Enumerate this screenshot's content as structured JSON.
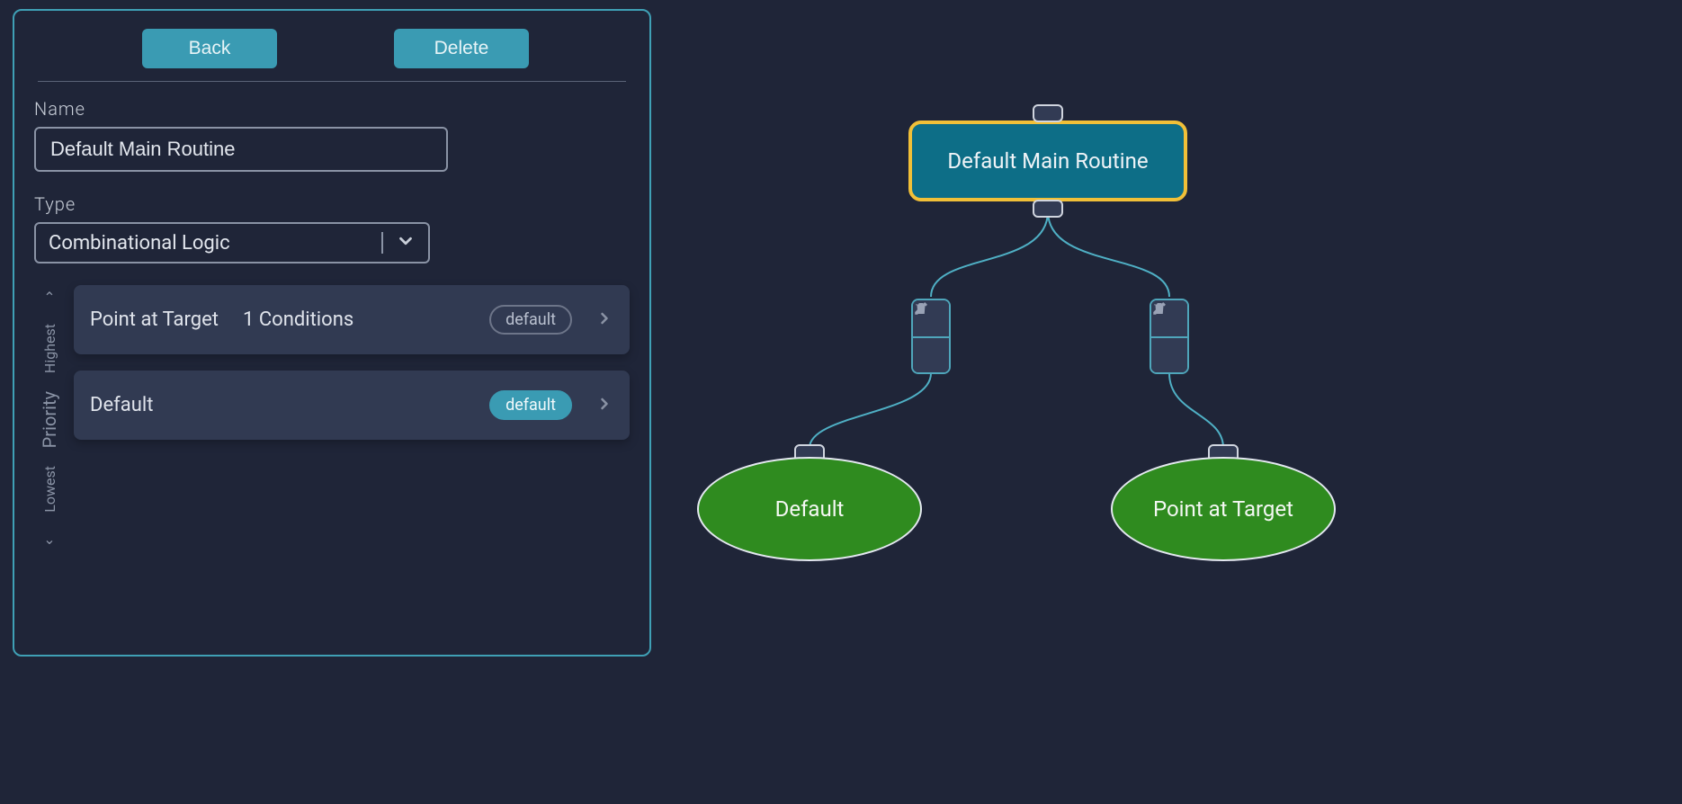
{
  "panel": {
    "buttons": {
      "back": "Back",
      "delete": "Delete"
    },
    "name_label": "Name",
    "name_value": "Default Main Routine",
    "type_label": "Type",
    "type_value": "Combinational Logic",
    "priority": {
      "label": "Priority",
      "high": "Highest",
      "low": "Lowest"
    },
    "items": [
      {
        "name": "Point at Target",
        "conditions": "1 Conditions",
        "badge": "default",
        "badge_style": "outline"
      },
      {
        "name": "Default",
        "conditions": "",
        "badge": "default",
        "badge_style": "filled"
      }
    ]
  },
  "graph": {
    "root": "Default Main Routine",
    "leaves": [
      {
        "label": "Default"
      },
      {
        "label": "Point at Target"
      }
    ]
  }
}
